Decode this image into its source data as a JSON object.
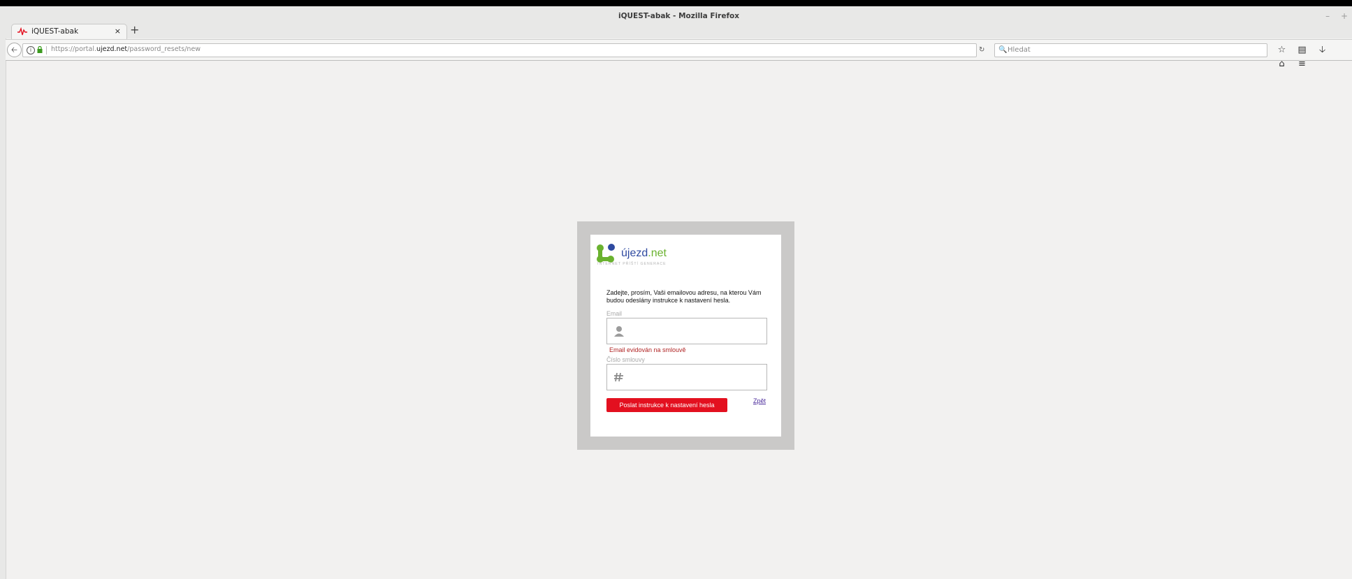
{
  "window": {
    "title": "iQUEST-abak - Mozilla Firefox",
    "controls": [
      "–",
      "+"
    ]
  },
  "tab": {
    "title": "iQUEST-abak",
    "close": "×",
    "new_tab": "+"
  },
  "navbar": {
    "url_prefix": "https://portal.",
    "url_domain": "ujezd.net",
    "url_path": "/password_resets/new",
    "search_placeholder": "Hledat"
  },
  "logo": {
    "name_main": "újezd",
    "name_suffix": ".net",
    "tagline": "INTERNET PŘÍŠTÍ GENERACE"
  },
  "form": {
    "instructions": "Zadejte, prosím, Vaši emailovou adresu, na kterou Vám budou odeslány instrukce k nastavení hesla.",
    "email_label": "Email",
    "email_value": "",
    "email_error": "Email evidován na smlouvě",
    "contract_label": "Číslo smlouvy",
    "contract_value": "",
    "submit_label": "Poslat instrukce k nastavení hesla",
    "back_label": "Zpět"
  },
  "colors": {
    "accent": "#e3101f",
    "error": "#b02424",
    "brand_blue": "#2f4aa0",
    "brand_green": "#6ab22f"
  }
}
